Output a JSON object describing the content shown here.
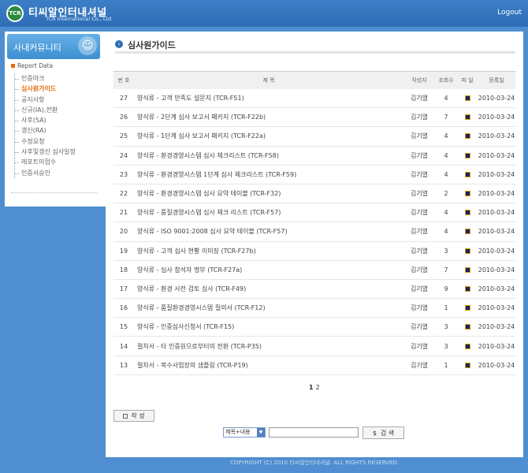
{
  "header": {
    "logo_text": "TCR",
    "brand": "티씨알인터내셔널",
    "brand_sub": "TCR International Co., Ltd",
    "logout": "Logout"
  },
  "sidebar": {
    "title": "사내커뮤니티",
    "section": "Report Data",
    "items": [
      {
        "label": "인증마크"
      },
      {
        "label": "심사원가이드"
      },
      {
        "label": "공지사항"
      },
      {
        "label": "신규(IA),전환"
      },
      {
        "label": "사후(SA)"
      },
      {
        "label": "갱신(RA)"
      },
      {
        "label": "수정요청"
      },
      {
        "label": "사후및갱신 심사일정"
      },
      {
        "label": "레포트미접수"
      },
      {
        "label": "인증서승인"
      }
    ]
  },
  "page": {
    "title": "심사원가이드"
  },
  "table": {
    "headers": {
      "no": "번 호",
      "title": "제 목",
      "author": "작성자",
      "views": "조회수",
      "file": "파 일",
      "date": "등록일"
    },
    "rows": [
      {
        "no": "27",
        "title": "양식류 - 고객 만족도 설문지 (TCR-F51)",
        "author": "김기열",
        "views": "4",
        "date": "2010-03-24"
      },
      {
        "no": "26",
        "title": "양식류 - 2단계 심사 보고서 패키지 (TCR-F22b)",
        "author": "김기열",
        "views": "7",
        "date": "2010-03-24"
      },
      {
        "no": "25",
        "title": "양식류 - 1단계 심사 보고서 패키지 (TCR-F22a)",
        "author": "김기열",
        "views": "4",
        "date": "2010-03-24"
      },
      {
        "no": "24",
        "title": "양식류 - 환경경영시스템 심사 체크리스트 (TCR-F58)",
        "author": "김기열",
        "views": "4",
        "date": "2010-03-24"
      },
      {
        "no": "23",
        "title": "양식류 - 환경경영시스템 1단계 심사 체크리스트 (TCR-F59)",
        "author": "김기열",
        "views": "4",
        "date": "2010-03-24"
      },
      {
        "no": "22",
        "title": "양식류 - 환경경영시스템 심사 요약 테이블 (TCR-F32)",
        "author": "김기열",
        "views": "2",
        "date": "2010-03-24"
      },
      {
        "no": "21",
        "title": "양식류 - 품질경영시스템 심사 체크 리스트 (TCR-F57)",
        "author": "김기열",
        "views": "4",
        "date": "2010-03-24"
      },
      {
        "no": "20",
        "title": "양식류 - ISO 9001:2008 심사 요약 테이블 (TCR-F57)",
        "author": "김기열",
        "views": "4",
        "date": "2010-03-24"
      },
      {
        "no": "19",
        "title": "양식류 - 고객 심사 현황 이미징 (TCR-F27b)",
        "author": "김기열",
        "views": "3",
        "date": "2010-03-24"
      },
      {
        "no": "18",
        "title": "양식류 - 심사 참석자 명부 (TCR-F27a)",
        "author": "김기열",
        "views": "7",
        "date": "2010-03-24"
      },
      {
        "no": "17",
        "title": "양식류 - 환경 사전 검토 심사 (TCR-F49)",
        "author": "김기열",
        "views": "9",
        "date": "2010-03-24"
      },
      {
        "no": "16",
        "title": "양식류 - 품질환경경영시스템 질의서 (TCR-F12)",
        "author": "김기열",
        "views": "1",
        "date": "2010-03-24"
      },
      {
        "no": "15",
        "title": "양식류 - 인증심사신청서 (TCR-F15)",
        "author": "김기열",
        "views": "3",
        "date": "2010-03-24"
      },
      {
        "no": "14",
        "title": "절차서 - 타 인증원으로부터의 전환 (TCR-P35)",
        "author": "김기열",
        "views": "3",
        "date": "2010-03-24"
      },
      {
        "no": "13",
        "title": "절차서 - 복수사업장의 샘플링 (TCR-P19)",
        "author": "김기열",
        "views": "1",
        "date": "2010-03-24"
      }
    ]
  },
  "pagination": {
    "pages": [
      "1",
      "2"
    ]
  },
  "actions": {
    "write": "작    성"
  },
  "search": {
    "select_value": "제목+내용",
    "button": "검    색"
  },
  "footer": {
    "copyright": "COPYRIGHT (C) 2010 티씨알인터내셔널. ALL RIGHTS RESERVED."
  },
  "colors": {
    "header_bg": "#2d6db6",
    "body_bg": "#4f8ed0",
    "active": "#e46c0a"
  }
}
